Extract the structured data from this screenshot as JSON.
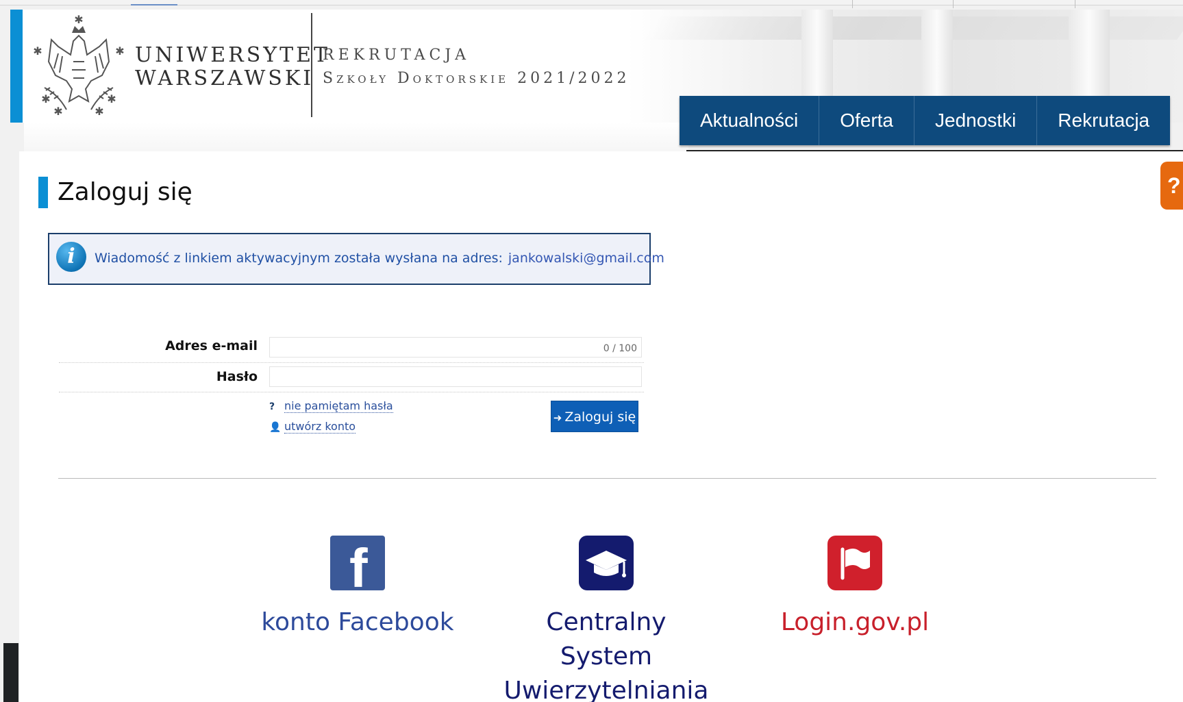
{
  "header": {
    "university_line1": "UNIWERSYTET",
    "university_line2": "WARSZAWSKI",
    "recruitment_line1": "REKRUTACJA",
    "recruitment_line2": "Szkoły Doktorskie 2021/2022"
  },
  "nav": {
    "items": [
      {
        "label": "Aktualności"
      },
      {
        "label": "Oferta"
      },
      {
        "label": "Jednostki"
      },
      {
        "label": "Rekrutacja"
      }
    ]
  },
  "help_tab": {
    "label": "?"
  },
  "page": {
    "title": "Zaloguj się"
  },
  "info": {
    "icon": "info-icon",
    "message": "Wiadomość z linkiem aktywacyjnym została wysłana na adres:",
    "email": "jankowalski@gmail.com"
  },
  "form": {
    "email_label": "Adres e-mail",
    "email_value": "",
    "email_counter": "0 / 100",
    "password_label": "Hasło",
    "password_value": "",
    "forgot_link": "nie pamiętam hasła",
    "create_account_link": "utwórz konto",
    "submit_label": "Zaloguj się"
  },
  "external_logins": [
    {
      "label": "konto Facebook",
      "icon": "facebook-icon",
      "color": "#3b5998"
    },
    {
      "label_line1": "Centralny System",
      "label_line2": "Uwierzytelniania",
      "icon": "graduation-cap-icon",
      "color": "#141b6e"
    },
    {
      "label": "Login.gov.pl",
      "icon": "flag-icon",
      "color": "#d0202c"
    }
  ],
  "colors": {
    "accent": "#0b8fd4",
    "nav": "#0e4a7d",
    "button": "#0e5fb6",
    "help": "#e6690f"
  }
}
